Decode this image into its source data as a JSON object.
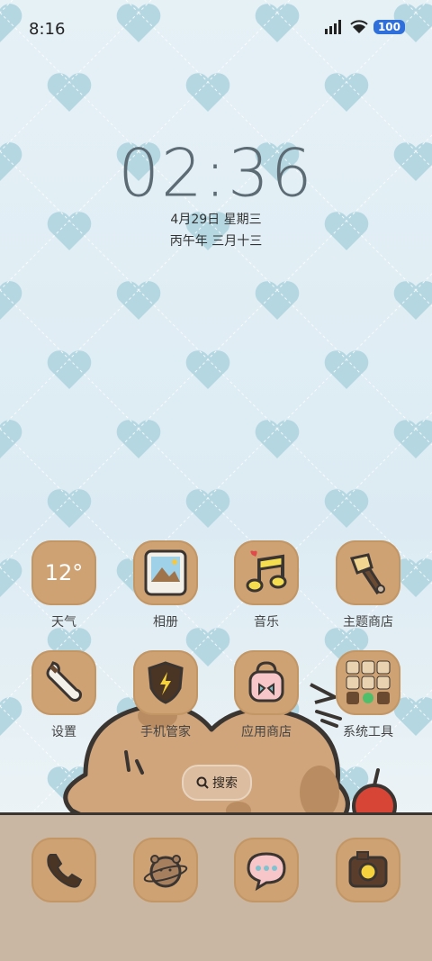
{
  "status": {
    "time": "8:16",
    "battery": "100"
  },
  "clock": {
    "time": "02:36",
    "date": "4月29日 星期三",
    "lunar": "丙午年 三月十三"
  },
  "weather": {
    "temp": "12°"
  },
  "apps_row1": [
    {
      "label": "天气",
      "icon": "weather-icon"
    },
    {
      "label": "相册",
      "icon": "gallery-icon"
    },
    {
      "label": "音乐",
      "icon": "music-icon"
    },
    {
      "label": "主题商店",
      "icon": "theme-store-icon"
    }
  ],
  "apps_row2": [
    {
      "label": "设置",
      "icon": "settings-wrench-icon"
    },
    {
      "label": "手机管家",
      "icon": "phone-manager-shield-icon"
    },
    {
      "label": "应用商店",
      "icon": "app-store-bag-icon"
    },
    {
      "label": "系统工具",
      "icon": "system-tools-folder-icon"
    }
  ],
  "search": {
    "label": "搜索"
  },
  "dock": [
    {
      "icon": "phone-icon"
    },
    {
      "icon": "browser-planet-icon"
    },
    {
      "icon": "messages-icon"
    },
    {
      "icon": "camera-icon"
    }
  ],
  "colors": {
    "tile": "#cfa273",
    "battery": "#2f6fdc",
    "floor": "#c9b7a3"
  }
}
